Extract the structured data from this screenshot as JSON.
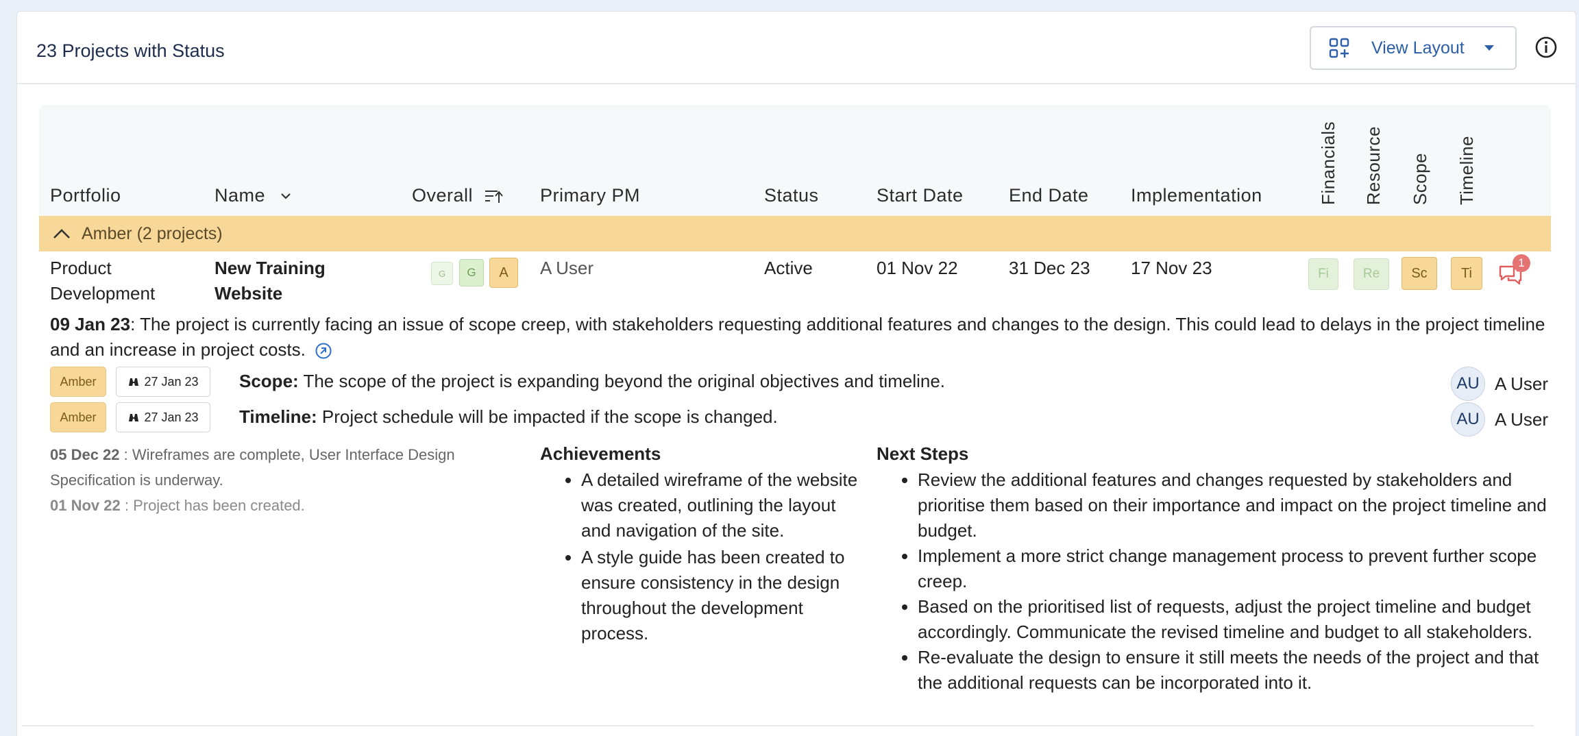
{
  "header": {
    "title": "23 Projects with Status",
    "view_layout_label": "View Layout"
  },
  "columns": {
    "portfolio": "Portfolio",
    "name": "Name",
    "overall": "Overall",
    "primary_pm": "Primary PM",
    "status": "Status",
    "start_date": "Start Date",
    "end_date": "End Date",
    "implementation": "Implementation",
    "financials": "Financials",
    "resource": "Resource",
    "scope": "Scope",
    "timeline": "Timeline"
  },
  "group": {
    "label": "Amber (2 projects)"
  },
  "project": {
    "portfolio_line1": "Product",
    "portfolio_line2": "Development",
    "name_line1": "New Training",
    "name_line2": "Website",
    "overall_pills": [
      "G",
      "G",
      "A"
    ],
    "primary_pm": "A User",
    "status": "Active",
    "start_date": "01 Nov 22",
    "end_date": "31 Dec 23",
    "implementation": "17 Nov 23",
    "rag": {
      "fi": "Fi",
      "re": "Re",
      "sc": "Sc",
      "ti": "Ti"
    },
    "comment_count": "1",
    "latest_update_date": "09 Jan 23",
    "latest_update_text": ": The project is currently facing an issue of scope creep, with stakeholders requesting additional features and changes to the design. This could lead to delays in the project timeline and an increase in project costs.",
    "risks": [
      {
        "badge": "Amber",
        "date": "27 Jan 23",
        "label": "Scope:",
        "text": " The scope of the project is expanding beyond the original objectives and timeline.",
        "owner_initials": "AU",
        "owner": "A User"
      },
      {
        "badge": "Amber",
        "date": "27 Jan 23",
        "label": "Timeline:",
        "text": " Project schedule will be impacted if the scope is changed.",
        "owner_initials": "AU",
        "owner": "A User"
      }
    ],
    "history": [
      {
        "date": "05 Dec 22",
        "text": " : Wireframes are complete, User Interface Design Specification is underway."
      },
      {
        "date": "01 Nov 22",
        "text": " : Project has been created."
      }
    ],
    "achievements_title": "Achievements",
    "achievements": [
      "A detailed wireframe of the website was created, outlining the layout and navigation of the site.",
      "A style guide has been created to ensure consistency in the design throughout the development process."
    ],
    "next_steps_title": "Next Steps",
    "next_steps": [
      "Review the additional features and changes requested by stakeholders and prioritise them based on their importance and impact on the project timeline and budget.",
      "Implement a more strict change management process to prevent further scope creep.",
      "Based on the prioritised list of requests, adjust the project timeline and budget accordingly. Communicate the revised timeline and budget to all stakeholders.",
      "Re-evaluate the design to ensure it still meets the needs of the project and that the additional requests can be incorporated into it."
    ]
  },
  "colors": {
    "amber": "#f8d898",
    "green_light": "#e3f1db",
    "accent_blue": "#2b5ea7",
    "comment_red": "#e05d5d"
  }
}
